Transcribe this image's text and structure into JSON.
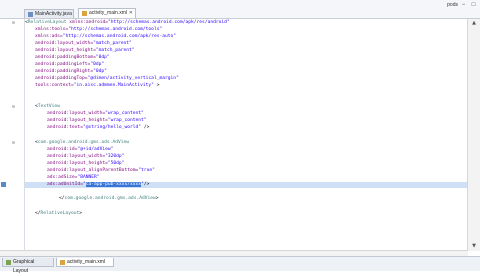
{
  "tabs": [
    {
      "label": "MainActivity.java",
      "active": false
    },
    {
      "label": "activity_main.xml",
      "active": true
    }
  ],
  "top_right_label": "pods",
  "bottom_tabs": [
    {
      "label": "Graphical Layout",
      "active": false
    },
    {
      "label": "activity_main.xml",
      "active": true
    }
  ],
  "code": {
    "l1": {
      "open": "<",
      "tag": "RelativeLayout",
      "attr": " xmlns:android=",
      "val": "\"http://schemas.android.com/apk/res/android\""
    },
    "l2": {
      "attr": "xmlns:tools=",
      "val": "\"http://schemas.android.com/tools\""
    },
    "l3": {
      "attr": "xmlns:ads=",
      "val": "\"http://schemas.android.com/apk/res-auto\""
    },
    "l4": {
      "attr": "android:layout_width=",
      "val": "\"match_parent\""
    },
    "l5": {
      "attr": "android:layout_height=",
      "val": "\"match_parent\""
    },
    "l6": {
      "attr": "android:paddingBottom=",
      "val": "\"0dp\""
    },
    "l7": {
      "attr": "android:paddingLeft=",
      "val": "\"0dp\""
    },
    "l8": {
      "attr": "android:paddingRight=",
      "val": "\"0dp\""
    },
    "l9": {
      "attr": "android:paddingTop=",
      "val": "\"@dimen/activity_vertical_margin\""
    },
    "l10": {
      "attr": "tools:context=",
      "val": "\"in.aisc.admmen.MainActivity\"",
      "close": " >"
    },
    "l11": {
      "open": "<",
      "tag": "TextView"
    },
    "l12": {
      "attr": "android:layout_width=",
      "val": "\"wrap_content\""
    },
    "l13": {
      "attr": "android:layout_height=",
      "val": "\"wrap_content\""
    },
    "l14": {
      "attr": "android:text=",
      "val": "\"@string/hello_world\"",
      "close": " />"
    },
    "l15": {
      "open": "<",
      "tag": "com.google.android.gms.ads.AdView"
    },
    "l16": {
      "attr": "android:id=",
      "val": "\"@+id/adView\""
    },
    "l17": {
      "attr": "android:layout_width=",
      "val": "\"320dp\""
    },
    "l18": {
      "attr": "android:layout_height=",
      "val": "\"50dp\""
    },
    "l19": {
      "attr": "android:layout_alignParentBottom=",
      "val": "\"true\""
    },
    "l20": {
      "attr": "ads:adSize=",
      "val": "\"BANNER\""
    },
    "l21": {
      "attr": "ads:adUnitId=",
      "val": "\"",
      "hl": "ca-app-pub-xxxx/xxxx",
      "val_end": "\"",
      "close": "/>"
    },
    "l22": {
      "open": "</",
      "tag": "com.google.android.gms.ads.AdView",
      "close": ">"
    },
    "l23": {
      "open": "</",
      "tag": "RelativeLayout",
      "close": ">"
    }
  }
}
